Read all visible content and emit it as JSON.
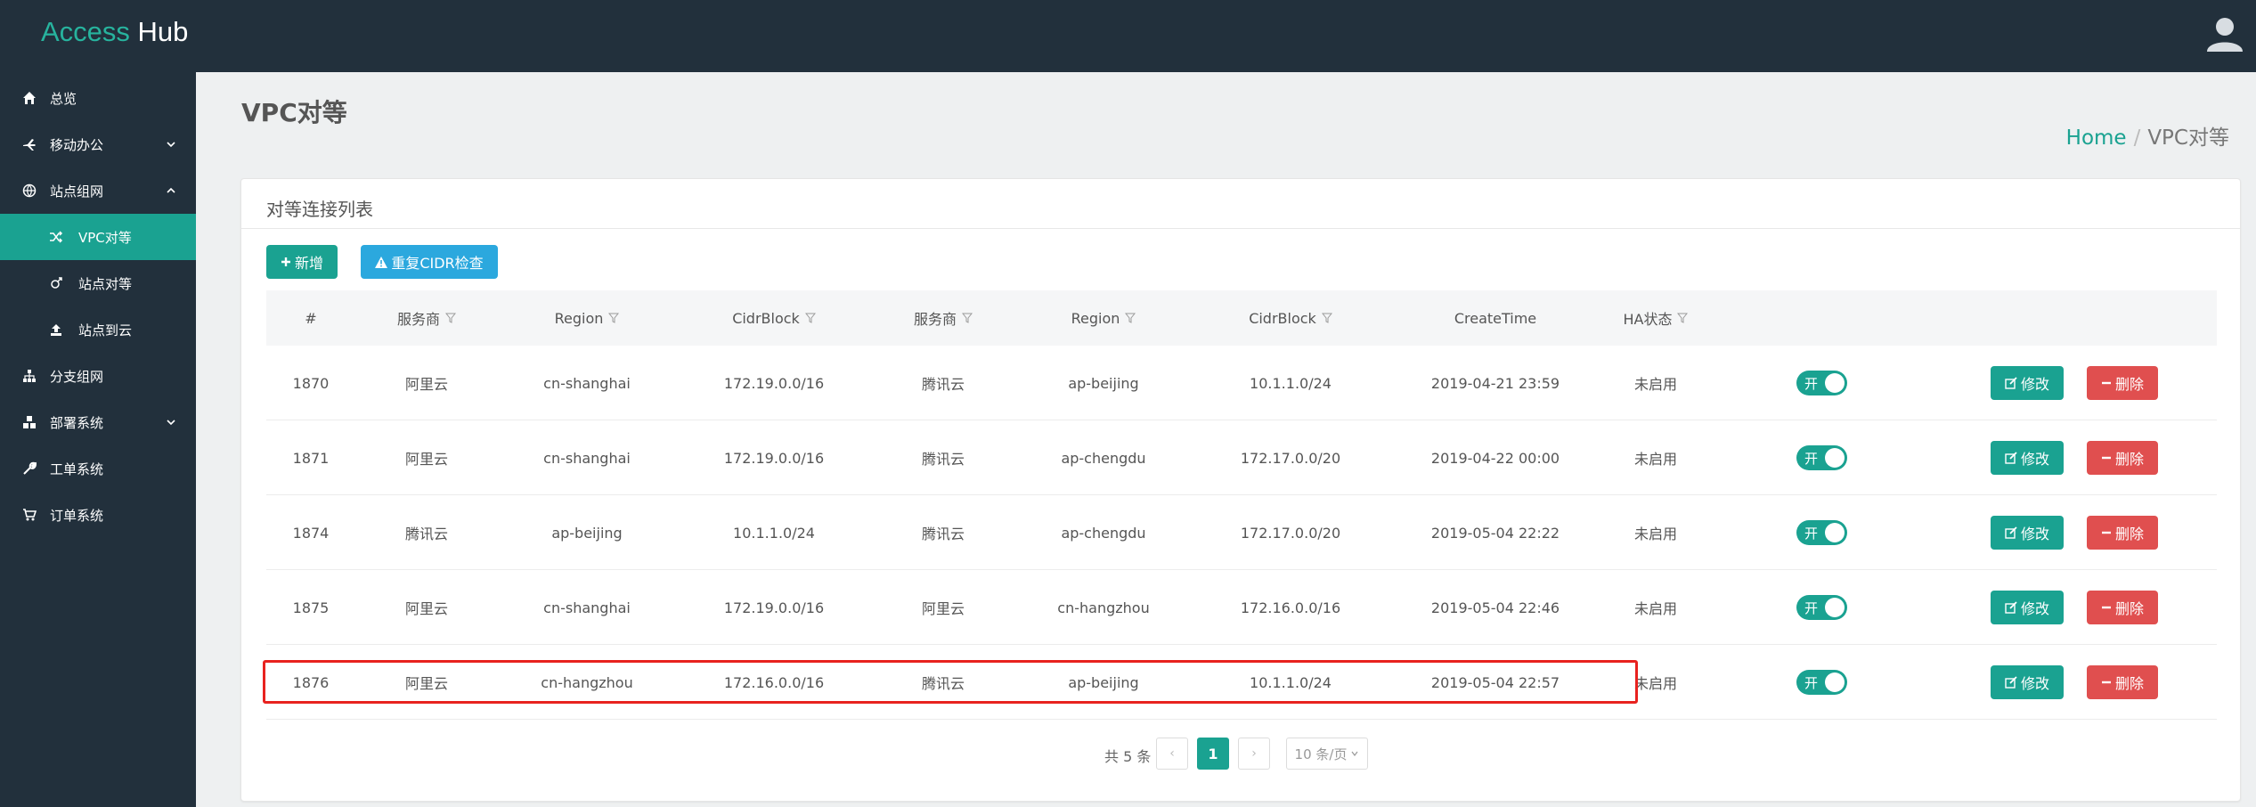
{
  "app": {
    "brand_part1": "Access",
    "brand_part2": "Hub"
  },
  "sidebar": {
    "items": [
      {
        "label": "总览",
        "icon": "home-icon"
      },
      {
        "label": "移动办公",
        "icon": "plane-icon"
      },
      {
        "label": "站点组网",
        "icon": "network-icon"
      },
      {
        "label": "VPC对等",
        "icon": "shuffle-icon"
      },
      {
        "label": "站点对等",
        "icon": "link-icon"
      },
      {
        "label": "站点到云",
        "icon": "upload-icon"
      },
      {
        "label": "分支组网",
        "icon": "sitemap-icon"
      },
      {
        "label": "部署系统",
        "icon": "cubes-icon"
      },
      {
        "label": "工单系统",
        "icon": "wrench-icon"
      },
      {
        "label": "订单系统",
        "icon": "cart-icon"
      }
    ]
  },
  "page": {
    "title": "VPC对等"
  },
  "breadcrumb": {
    "home": "Home",
    "sep": "/",
    "current": "VPC对等"
  },
  "card": {
    "title": "对等连接列表"
  },
  "toolbar": {
    "add_label": "新增",
    "check_label": "重复CIDR检查"
  },
  "table": {
    "columns": [
      "#",
      "服务商",
      "Region",
      "CidrBlock",
      "服务商",
      "Region",
      "CidrBlock",
      "CreateTime",
      "HA状态"
    ],
    "rows": [
      {
        "id": "1870",
        "p1": "阿里云",
        "r1": "cn-shanghai",
        "c1": "172.19.0.0/16",
        "p2": "腾讯云",
        "r2": "ap-beijing",
        "c2": "10.1.1.0/24",
        "time": "2019-04-21 23:59",
        "ha": "未启用",
        "switch": "开",
        "edit": "修改",
        "del": "删除"
      },
      {
        "id": "1871",
        "p1": "阿里云",
        "r1": "cn-shanghai",
        "c1": "172.19.0.0/16",
        "p2": "腾讯云",
        "r2": "ap-chengdu",
        "c2": "172.17.0.0/20",
        "time": "2019-04-22 00:00",
        "ha": "未启用",
        "switch": "开",
        "edit": "修改",
        "del": "删除"
      },
      {
        "id": "1874",
        "p1": "腾讯云",
        "r1": "ap-beijing",
        "c1": "10.1.1.0/24",
        "p2": "腾讯云",
        "r2": "ap-chengdu",
        "c2": "172.17.0.0/20",
        "time": "2019-05-04 22:22",
        "ha": "未启用",
        "switch": "开",
        "edit": "修改",
        "del": "删除"
      },
      {
        "id": "1875",
        "p1": "阿里云",
        "r1": "cn-shanghai",
        "c1": "172.19.0.0/16",
        "p2": "阿里云",
        "r2": "cn-hangzhou",
        "c2": "172.16.0.0/16",
        "time": "2019-05-04 22:46",
        "ha": "未启用",
        "switch": "开",
        "edit": "修改",
        "del": "删除"
      },
      {
        "id": "1876",
        "p1": "阿里云",
        "r1": "cn-hangzhou",
        "c1": "172.16.0.0/16",
        "p2": "腾讯云",
        "r2": "ap-beijing",
        "c2": "10.1.1.0/24",
        "time": "2019-05-04 22:57",
        "ha": "未启用",
        "switch": "开",
        "edit": "修改",
        "del": "删除"
      }
    ]
  },
  "pagination": {
    "total": "共 5 条",
    "current": "1",
    "prev": "‹",
    "next": "›",
    "page_size": "10 条/页"
  },
  "colors": {
    "accent": "#1aa291",
    "info": "#2ba8de",
    "danger": "#e04f4f",
    "sidebar": "#22303c",
    "highlight": "#e8221f"
  }
}
